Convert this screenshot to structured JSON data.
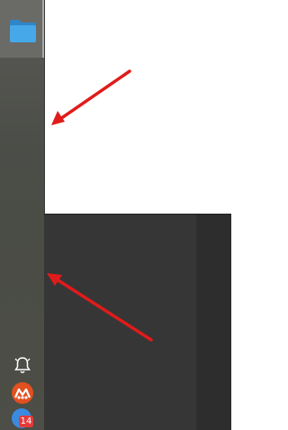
{
  "dock": {
    "top_item": {
      "icon": "folder-icon",
      "color": "#3d9cdc",
      "active": true
    },
    "bottom_items": [
      {
        "icon": "bell-icon"
      },
      {
        "icon": "app-logo-icon",
        "color": "#e2501f"
      },
      {
        "icon": "notification-icon",
        "color": "#3a8be0",
        "badge": "14"
      }
    ]
  },
  "annotations": {
    "arrow_color": "#e01b1b",
    "arrows": [
      "upper-arrow",
      "lower-arrow"
    ]
  }
}
